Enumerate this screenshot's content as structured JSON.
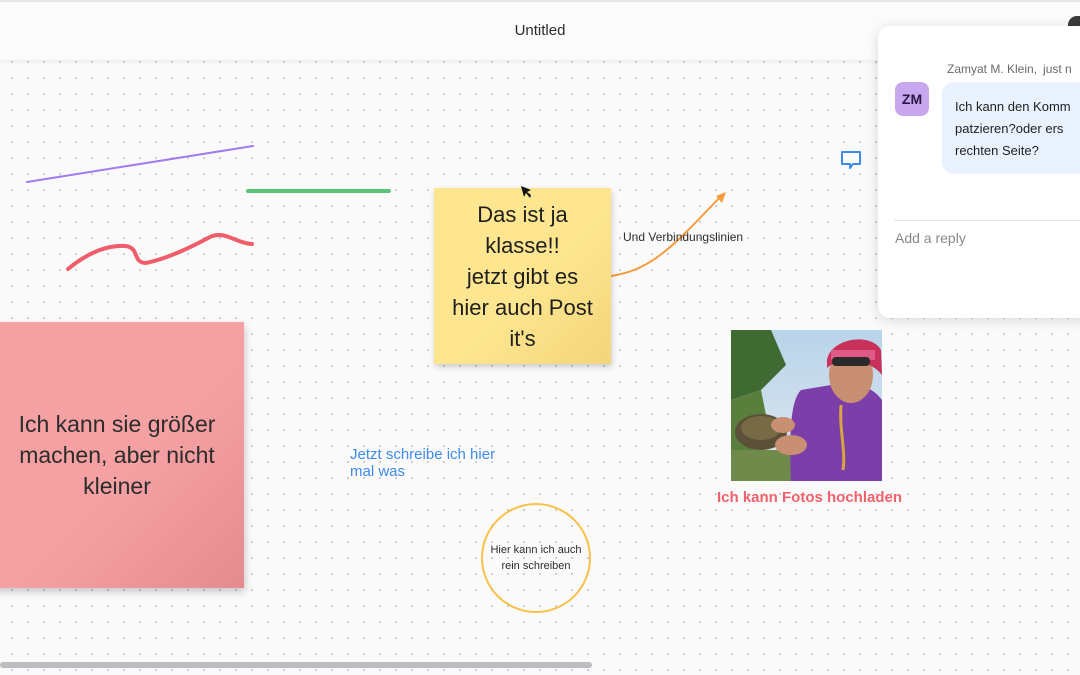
{
  "header": {
    "title": "Untitled"
  },
  "canvas": {
    "sticky_yellow": "Das ist ja\nklasse!!\njetzt gibt es\nhier auch Post\nit's",
    "sticky_pink": "Ich kann sie größer\nmachen, aber nicht\nkleiner",
    "connector_label": "Und Verbindungslinien",
    "blue_text": "Jetzt schreibe ich hier\nmal was",
    "circle_text": "Hier kann ich auch\nrein schreiben",
    "photo_caption": "Ich kann Fotos hochladen"
  },
  "comment_panel": {
    "avatar_initials": "ZM",
    "author": "Zamyat M. Klein,",
    "time": "just n",
    "message": "Ich kann den Komm\npatzieren?oder ers\nrechten Seite?",
    "reply_placeholder": "Add a reply"
  },
  "colors": {
    "accent_blue": "#3d8ce8",
    "sticky_yellow": "#fde68f",
    "sticky_pink": "#f5a1a3",
    "caption_red": "#f0616b",
    "circle_border": "#f7c14b"
  },
  "icons": [
    "comment-icon",
    "cursor-icon"
  ]
}
